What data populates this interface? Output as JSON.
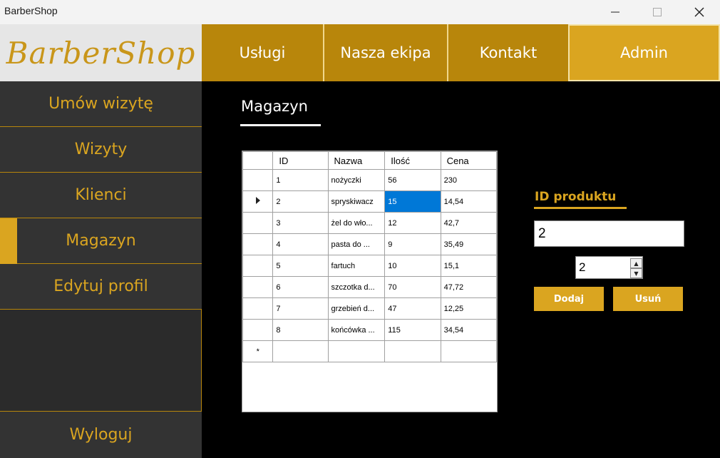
{
  "window": {
    "title": "BarberShop",
    "controls": {
      "minimize": "minimize-icon",
      "maximize": "maximize-icon",
      "close": "close-icon"
    }
  },
  "logo": {
    "text": "BarberShop"
  },
  "topnav": {
    "items": [
      {
        "label": "Usługi"
      },
      {
        "label": "Nasza ekipa"
      },
      {
        "label": "Kontakt"
      },
      {
        "label": "Admin"
      }
    ],
    "active": "Admin"
  },
  "sidebar": {
    "items": [
      {
        "label": "Umów wizytę"
      },
      {
        "label": "Wizyty"
      },
      {
        "label": "Klienci"
      },
      {
        "label": "Magazyn"
      },
      {
        "label": "Edytuj profil"
      }
    ],
    "active": "Magazyn",
    "logout": "Wyloguj"
  },
  "main": {
    "title": "Magazyn",
    "grid": {
      "columns": [
        "ID",
        "Nazwa",
        "Ilość",
        "Cena"
      ],
      "rows": [
        [
          "1",
          "nożyczki",
          "56",
          "230"
        ],
        [
          "2",
          "spryskiwacz",
          "15",
          "14,54"
        ],
        [
          "3",
          "żel do wło...",
          "12",
          "42,7"
        ],
        [
          "4",
          "pasta do ...",
          "9",
          "35,49"
        ],
        [
          "5",
          "fartuch",
          "10",
          "15,1"
        ],
        [
          "6",
          "szczotka d...",
          "70",
          "47,72"
        ],
        [
          "7",
          "grzebień d...",
          "47",
          "12,25"
        ],
        [
          "8",
          "końcówka ...",
          "115",
          "34,54"
        ]
      ],
      "new_row_marker": "*",
      "current_row": 2
    },
    "product": {
      "id_label": "ID produktu",
      "id_value": "2",
      "quantity": "2",
      "add_label": "Dodaj",
      "remove_label": "Usuń"
    }
  },
  "colors": {
    "accent": "#daa520",
    "nav": "#b8860b",
    "sidebar": "#333333",
    "background": "#000000",
    "selection": "#0078d7"
  }
}
